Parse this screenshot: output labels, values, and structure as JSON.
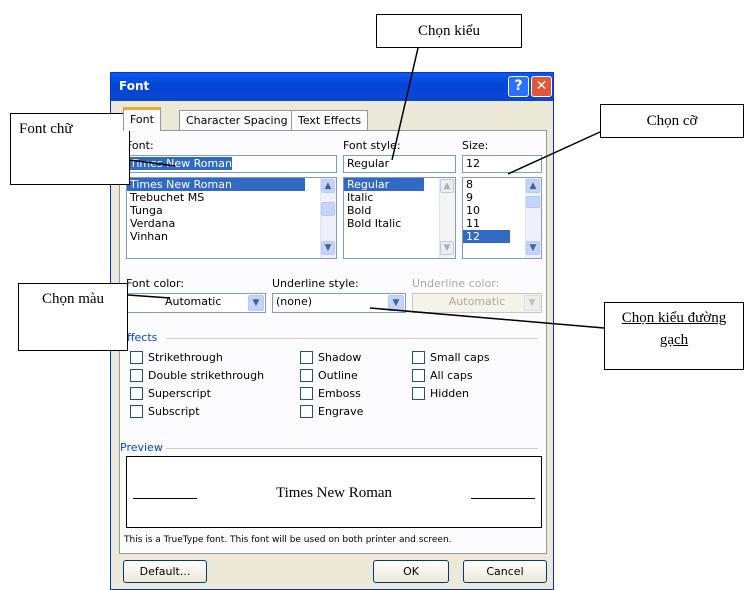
{
  "window": {
    "title": "Font",
    "help_glyph": "?",
    "close_glyph": "✕"
  },
  "tabs": [
    {
      "label": "Font",
      "active": true
    },
    {
      "label": "Character Spacing",
      "active": false
    },
    {
      "label": "Text Effects",
      "active": false
    }
  ],
  "font": {
    "label": "Font:",
    "value": "Times New Roman",
    "items": [
      "Times New Roman",
      "Trebuchet MS",
      "Tunga",
      "Verdana",
      "Vinhan"
    ],
    "selected": "Times New Roman"
  },
  "font_style": {
    "label": "Font style:",
    "value": "Regular",
    "items": [
      "Regular",
      "Italic",
      "Bold",
      "Bold Italic"
    ],
    "selected": "Regular"
  },
  "size": {
    "label": "Size:",
    "value": "12",
    "items": [
      "8",
      "9",
      "10",
      "11",
      "12"
    ],
    "selected": "12"
  },
  "font_color": {
    "label": "Font color:",
    "value": "Automatic"
  },
  "underline_style": {
    "label": "Underline style:",
    "value": "(none)"
  },
  "underline_color": {
    "label": "Underline color:",
    "value": "Automatic"
  },
  "effects": {
    "title": "Effects",
    "col1": [
      "Strikethrough",
      "Double strikethrough",
      "Superscript",
      "Subscript"
    ],
    "col2": [
      "Shadow",
      "Outline",
      "Emboss",
      "Engrave"
    ],
    "col3": [
      "Small caps",
      "All caps",
      "Hidden"
    ]
  },
  "preview": {
    "title": "Preview",
    "sample": "Times New Roman",
    "note": "This is a TrueType font. This font will be used on both printer and screen."
  },
  "buttons": {
    "default": "Default...",
    "ok": "OK",
    "cancel": "Cancel"
  },
  "callouts": {
    "font": "Font chữ",
    "style": "Chọn kiểu",
    "size": "Chọn cỡ",
    "color": "Chọn màu",
    "underline": "Chọn kiểu đường gạch"
  },
  "colors": {
    "titlebar": "#0546d8",
    "selection": "#316ac5",
    "dialog_bg": "#ece9d8",
    "tab_highlight": "#f3a830"
  }
}
